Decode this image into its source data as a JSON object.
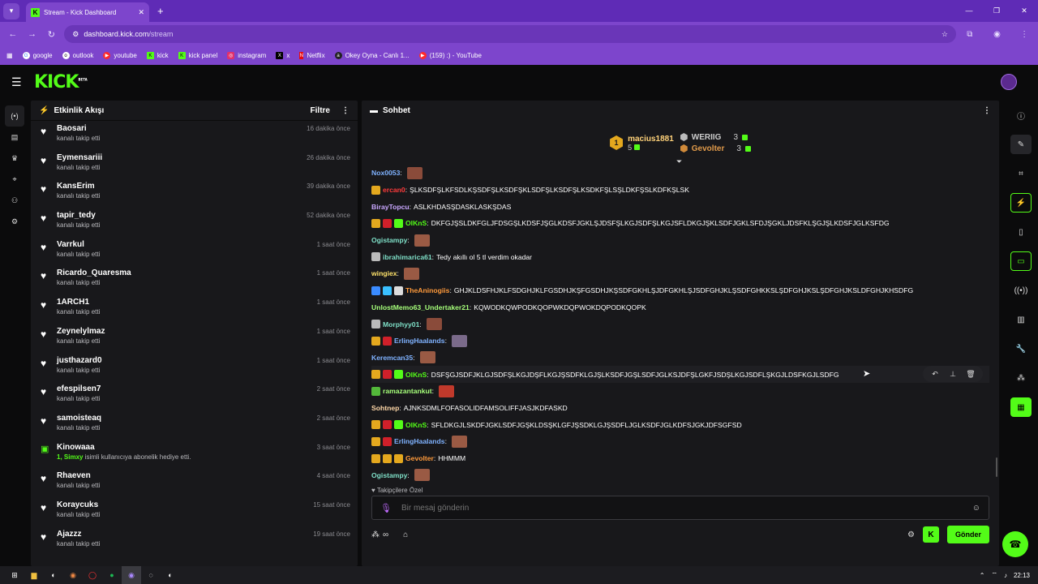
{
  "browser": {
    "tab_title": "Stream - Kick Dashboard",
    "url_domain": "dashboard.kick.com",
    "url_path": "/stream",
    "bookmarks": [
      {
        "label": "google",
        "color": "#ffffff"
      },
      {
        "label": "outlook",
        "color": "#ffffff"
      },
      {
        "label": "youtube",
        "color": "#ff2a2a"
      },
      {
        "label": "kick",
        "color": "#53fc18"
      },
      {
        "label": "kick panel",
        "color": "#53fc18"
      },
      {
        "label": "instagram",
        "color": "#e1306c"
      },
      {
        "label": "x",
        "color": "#000000"
      },
      {
        "label": "Netflix",
        "color": "#e50914"
      },
      {
        "label": "Okey Oyna - Canlı 1...",
        "color": "#222222"
      },
      {
        "label": "(159) :) - YouTube",
        "color": "#ff2a2a"
      }
    ]
  },
  "app": {
    "logo": "KICK",
    "logo_badge": "BETA"
  },
  "activity": {
    "title": "Etkinlik Akışı",
    "filter_label": "Filtre",
    "items": [
      {
        "name": "Baosari",
        "action": "kanalı takip etti",
        "time": "16 dakika önce",
        "type": "follow"
      },
      {
        "name": "Eymensariii",
        "action": "kanalı takip etti",
        "time": "26 dakika önce",
        "type": "follow"
      },
      {
        "name": "KansErim",
        "action": "kanalı takip etti",
        "time": "39 dakika önce",
        "type": "follow"
      },
      {
        "name": "tapir_tedy",
        "action": "kanalı takip etti",
        "time": "52 dakika önce",
        "type": "follow"
      },
      {
        "name": "Varrkul",
        "action": "kanalı takip etti",
        "time": "1 saat önce",
        "type": "follow"
      },
      {
        "name": "Ricardo_Quaresma",
        "action": "kanalı takip etti",
        "time": "1 saat önce",
        "type": "follow"
      },
      {
        "name": "1ARCH1",
        "action": "kanalı takip etti",
        "time": "1 saat önce",
        "type": "follow"
      },
      {
        "name": "Zeynelylmaz",
        "action": "kanalı takip etti",
        "time": "1 saat önce",
        "type": "follow"
      },
      {
        "name": "justhazard0",
        "action": "kanalı takip etti",
        "time": "1 saat önce",
        "type": "follow"
      },
      {
        "name": "efespilsen7",
        "action": "kanalı takip etti",
        "time": "2 saat önce",
        "type": "follow"
      },
      {
        "name": "samoisteaq",
        "action": "kanalı takip etti",
        "time": "2 saat önce",
        "type": "follow"
      },
      {
        "name": "Kinowaaa",
        "action": "isimli kullanıcıya abonelik hediye etti.",
        "highlight": "1, Simxy",
        "time": "3 saat önce",
        "type": "gift"
      },
      {
        "name": "Rhaeven",
        "action": "kanalı takip etti",
        "time": "4 saat önce",
        "type": "follow"
      },
      {
        "name": "Koraycuks",
        "action": "kanalı takip etti",
        "time": "15 saat önce",
        "type": "follow"
      },
      {
        "name": "Ajazzz",
        "action": "kanalı takip etti",
        "time": "19 saat önce",
        "type": "follow"
      }
    ]
  },
  "chat": {
    "title": "Sohbet",
    "leaderboard": {
      "top_name": "macius1881",
      "top_rank": "1",
      "top_count": "5",
      "second_name": "WERIIG",
      "second_count": "3",
      "third_name": "Gevolter",
      "third_count": "3"
    },
    "messages": [
      {
        "user": "Nox0053",
        "color": "#7fb2ff",
        "text": "",
        "emote": "#8a4b3a",
        "badges": []
      },
      {
        "user": "ercan0",
        "color": "#ff3b3b",
        "text": "ŞLKSDFŞLKFSDLKŞSDFŞLKSDFŞKLSDFŞLKSDFŞLKSDKFŞLSŞLDKFŞSLKDFKŞLSK",
        "emote": "",
        "badges": [
          "#e4a81e"
        ]
      },
      {
        "user": "BirayTopcu",
        "color": "#c9a7ff",
        "text": "ASLKHDASŞDASKLASKŞDAS",
        "emote": "",
        "badges": []
      },
      {
        "user": "OlKnS",
        "color": "#53fc18",
        "text": "DKFGJŞSLDKFGLJFDSGŞLKDSFJŞGLKDSFJGKLŞJDSFŞLKGJSDFŞLKGJSFLDKGJŞKLSDFJGKLSFDJŞGKLJDSFKLŞGJŞLKDSFJGLKSFDG",
        "emote": "",
        "badges": [
          "#e4a81e",
          "#d0202a",
          "#53fc18"
        ]
      },
      {
        "user": "Ogistampy",
        "color": "#7fe0c8",
        "text": "",
        "emote": "#9a5a44",
        "badges": []
      },
      {
        "user": "ibrahimarica61",
        "color": "#7fe0c8",
        "text": "Tedy akıllı ol 5 tl verdim okadar",
        "emote": "",
        "badges": [
          "#bbbbbb"
        ]
      },
      {
        "user": "wingiex",
        "color": "#ffe36b",
        "text": "",
        "emote": "#9a5a44",
        "badges": []
      },
      {
        "user": "TheAninogiis",
        "color": "#ff9a3b",
        "text": "GHJKLDSFHJKLFSDGHJKLFGSDHJKŞFGSDHJKŞSDFGKHLŞJDFGKHLŞJSDFGHJKLŞSDFGHKKSLŞDFGHJKSLŞDFGHJKSLDFGHJKHSDFG",
        "emote": "",
        "badges": [
          "#3a8bff",
          "#3ac0ff",
          "#dddddd"
        ]
      },
      {
        "user": "UnlostMemo63_Undertaker21",
        "color": "#a6ff7a",
        "text": "KQWODKQWPODKQOPWKDQPWOKDQPODKQOPK",
        "emote": "",
        "badges": []
      },
      {
        "user": "Morphyy01",
        "color": "#7fe0c8",
        "text": "",
        "emote": "#8a4b3a",
        "badges": [
          "#bbbbbb"
        ]
      },
      {
        "user": "ErlingHaalands",
        "color": "#7fb2ff",
        "text": "",
        "emote": "#7a6a8a",
        "badges": [
          "#e4a81e",
          "#d0202a"
        ]
      },
      {
        "user": "Keremcan35",
        "color": "#7fb2ff",
        "text": "",
        "emote": "#9a5a44",
        "badges": []
      },
      {
        "user": "OlKnS",
        "color": "#53fc18",
        "text": "DSFŞGJSDFJKLGJSDFŞLKGJDŞFLKGJŞSDFKLGJŞLKSDFJGŞLSDFJGLKSJDFŞLGKFJSDŞLKGJSDFLŞKGJLDSFKGJLSDFG",
        "emote": "",
        "badges": [
          "#e4a81e",
          "#d0202a",
          "#53fc18"
        ]
      },
      {
        "user": "ramazantankut",
        "color": "#a6ff7a",
        "text": "",
        "emote": "#c0392b",
        "badges": [
          "#53b83a"
        ]
      },
      {
        "user": "Sohtnep",
        "color": "#ffd8a8",
        "text": "AJNKSDMLFOFASOLIDFAMSOLIFFJASJKDFASKD",
        "emote": "",
        "badges": []
      },
      {
        "user": "OlKnS",
        "color": "#53fc18",
        "text": "SFLDKGJLSKDFJGKLSDFJGŞKLDSŞKLGFJŞSDKLGJŞSDFLJGLKSDFJGLKDFSJGKJDFSGFSD",
        "emote": "",
        "badges": [
          "#e4a81e",
          "#d0202a",
          "#53fc18"
        ]
      },
      {
        "user": "ErlingHaalands",
        "color": "#7fb2ff",
        "text": "",
        "emote": "#9a5a44",
        "badges": [
          "#e4a81e",
          "#d0202a"
        ]
      },
      {
        "user": "Gevolter",
        "color": "#ff9a3b",
        "text": "HHMMM",
        "emote": "",
        "badges": [
          "#e4a81e",
          "#e4a81e",
          "#e4a81e"
        ]
      },
      {
        "user": "Ogistampy",
        "color": "#7fe0c8",
        "text": "",
        "emote": "#9a5a44",
        "badges": []
      }
    ],
    "follower_label": "Takipçilere Özel",
    "emote_colors": [
      "#8a7a9a",
      "#3a7a3a",
      "#e8d020",
      "#30c060",
      "#e0b030",
      "#f0c030",
      "#e05a20",
      "#dddddd",
      "#c03040",
      "#7a6ac0"
    ],
    "input_placeholder": "Bir mesaj gönderin",
    "send_label": "Gönder"
  },
  "taskbar": {
    "clock": "22:13"
  }
}
